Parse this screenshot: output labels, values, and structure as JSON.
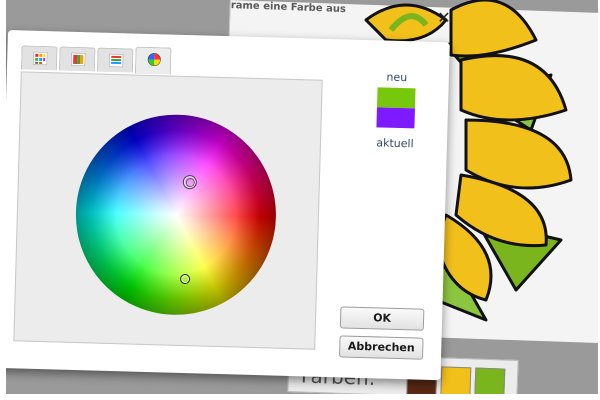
{
  "background": {
    "heading": "rame eine Farbe aus",
    "bottom_label": "Farben:",
    "close_symbol": "✕",
    "bottom_swatch_colors": [
      "#5a2a14",
      "#f2c01b",
      "#7ab51d"
    ]
  },
  "dialog": {
    "tabs": [
      {
        "icon": "swatch-grid-icon",
        "active": false
      },
      {
        "icon": "gradient-icon",
        "active": false
      },
      {
        "icon": "palette-list-icon",
        "active": false
      },
      {
        "icon": "color-wheel-icon",
        "active": true
      }
    ],
    "new_label": "neu",
    "current_label": "aktuell",
    "new_color": "#77c80c",
    "current_color": "#7d1aff",
    "ok_label": "OK",
    "cancel_label": "Abbrechen"
  }
}
